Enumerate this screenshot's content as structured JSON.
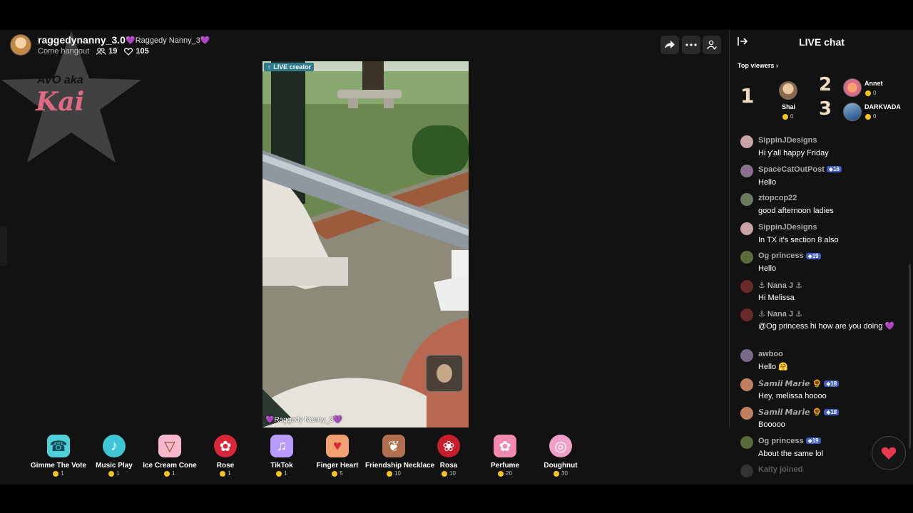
{
  "host": {
    "name": "raggedynanny_3.0",
    "tag": "💜Raggedy Nanny_3💜",
    "subtitle": "Come hangout",
    "viewers": "19",
    "likes": "105"
  },
  "watermark": {
    "line1": "AVO aka",
    "line2": "Kai"
  },
  "video": {
    "live_tag": "LIVE creator",
    "label": "💜Raggedy Nanny_3💜"
  },
  "gifts": [
    {
      "name": "Gimme The Vote",
      "price": "1",
      "icon": "phone-gift-icon",
      "color": "#4fd0d8",
      "glyph": "☎"
    },
    {
      "name": "Music Play",
      "price": "1",
      "icon": "music-gift-icon",
      "color": "#3ec6d6",
      "glyph": "♪"
    },
    {
      "name": "Ice Cream Cone",
      "price": "1",
      "icon": "ice-cream-gift-icon",
      "color": "#f7b8cc",
      "glyph": "🍦"
    },
    {
      "name": "Rose",
      "price": "1",
      "icon": "rose-gift-icon",
      "color": "#d8263a",
      "glyph": "🌹"
    },
    {
      "name": "TikTok",
      "price": "1",
      "icon": "tiktok-gift-icon",
      "color": "#b99bff",
      "glyph": "♫"
    },
    {
      "name": "Finger Heart",
      "price": "5",
      "icon": "finger-heart-gift-icon",
      "color": "#f2a070",
      "glyph": "✌"
    },
    {
      "name": "Friendship Necklace",
      "price": "10",
      "icon": "necklace-gift-icon",
      "color": "#b07050",
      "glyph": "❦"
    },
    {
      "name": "Rosa",
      "price": "10",
      "icon": "rosa-gift-icon",
      "color": "#c81e2c",
      "glyph": "🌹"
    },
    {
      "name": "Perfume",
      "price": "20",
      "icon": "perfume-gift-icon",
      "color": "#f08ab0",
      "glyph": "✿"
    },
    {
      "name": "Doughnut",
      "price": "30",
      "icon": "doughnut-gift-icon",
      "color": "#f0a0c8",
      "glyph": "◎"
    }
  ],
  "chat": {
    "title": "LIVE chat",
    "top_viewers_label": "Top viewers",
    "top_viewers": [
      {
        "rank": "1",
        "name": "Shai",
        "coins": "0"
      },
      {
        "rank": "2",
        "name": "Annet",
        "coins": "0"
      },
      {
        "rank": "3",
        "name": "DARKVADA",
        "coins": "0"
      }
    ],
    "messages": [
      {
        "user": "SippinJDesigns",
        "badge": "",
        "text": "Hi y'all happy Friday",
        "color": "#c9a3a8"
      },
      {
        "user": "SpaceCatOutPost",
        "badge": "16",
        "text": "Hello",
        "color": "#8a6e8f"
      },
      {
        "user": "ztopcop22",
        "badge": "",
        "text": "good afternoon ladies",
        "color": "#6a7a5a"
      },
      {
        "user": "SippinJDesigns",
        "badge": "",
        "text": "In TX it's section 8 also",
        "color": "#c9a3a8"
      },
      {
        "user": "Og princess",
        "badge": "19",
        "text": "Hello",
        "color": "#5a6a3a"
      },
      {
        "user": "⚓ Nana J ⚓",
        "badge": "",
        "text": "Hi Melissa",
        "color": "#6a2a2a"
      },
      {
        "user": "⚓ Nana J ⚓",
        "badge": "",
        "text": "@Og princess hi how are you doing 💜",
        "color": "#6a2a2a"
      },
      {
        "user": "awboo",
        "badge": "",
        "text": "Hello 🤗",
        "color": "#7a6a8a"
      },
      {
        "user": "𝙎𝙖𝙢𝙞𝙞 𝙈𝙖𝙧𝙞𝙚 🌻",
        "badge": "18",
        "text": "Hey, melissa hoooo",
        "color": "#c08060"
      },
      {
        "user": "𝙎𝙖𝙢𝙞𝙞 𝙈𝙖𝙧𝙞𝙚 🌻",
        "badge": "18",
        "text": "Booooo",
        "color": "#c08060"
      },
      {
        "user": "Og princess",
        "badge": "19",
        "text": "About the same lol",
        "color": "#5a6a3a"
      },
      {
        "user": "Kaity joined",
        "badge": "",
        "text": "",
        "color": "#555555"
      }
    ]
  }
}
